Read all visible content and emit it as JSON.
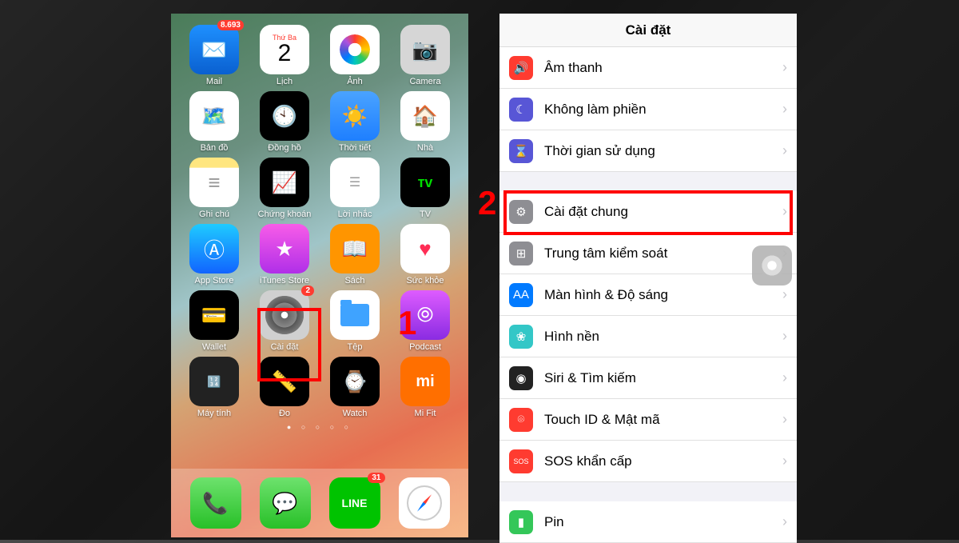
{
  "homescreen": {
    "calendar_day_label": "Thứ Ba",
    "calendar_day_number": "2",
    "apps": {
      "mail": "Mail",
      "calendar": "Lịch",
      "photos": "Ảnh",
      "camera": "Camera",
      "maps": "Bản đồ",
      "clock": "Đồng hồ",
      "weather": "Thời tiết",
      "home": "Nhà",
      "notes": "Ghi chú",
      "stocks": "Chứng khoán",
      "reminders": "Lời nhắc",
      "tv": "TV",
      "appstore": "App Store",
      "itunes": "iTunes Store",
      "books": "Sách",
      "health": "Sức khỏe",
      "wallet": "Wallet",
      "settings": "Cài đặt",
      "files": "Tệp",
      "podcast": "Podcast",
      "calculator": "Máy tính",
      "measure": "Đo",
      "watch": "Watch",
      "mifit": "Mi Fit"
    },
    "badges": {
      "mail": "8.693",
      "settings": "2",
      "line": "31"
    },
    "tv_glyph": "ᴛᴠ",
    "mifit_glyph": "mi",
    "line_glyph": "LINE"
  },
  "steps": {
    "one": "1",
    "two": "2"
  },
  "settings": {
    "title": "Cài đặt",
    "items": [
      {
        "label": "Âm thanh",
        "color": "#ff3b30",
        "glyph": "🔊"
      },
      {
        "label": "Không làm phiền",
        "color": "#5856d6",
        "glyph": "☾"
      },
      {
        "label": "Thời gian sử dụng",
        "color": "#5856d6",
        "glyph": "⌛"
      },
      {
        "label": "Cài đặt chung",
        "color": "#8e8e93",
        "glyph": "⚙"
      },
      {
        "label": "Trung tâm kiểm soát",
        "color": "#8e8e93",
        "glyph": "⊞"
      },
      {
        "label": "Màn hình & Độ sáng",
        "color": "#007aff",
        "glyph": "AA"
      },
      {
        "label": "Hình nền",
        "color": "#33c7c7",
        "glyph": "❀"
      },
      {
        "label": "Siri & Tìm kiếm",
        "color": "#222",
        "glyph": "◉"
      },
      {
        "label": "Touch ID & Mật mã",
        "color": "#ff3b30",
        "glyph": "⌾"
      },
      {
        "label": "SOS khẩn cấp",
        "color": "#ff3b30",
        "glyph": "SOS"
      },
      {
        "label": "Pin",
        "color": "#34c759",
        "glyph": "▮"
      }
    ]
  }
}
